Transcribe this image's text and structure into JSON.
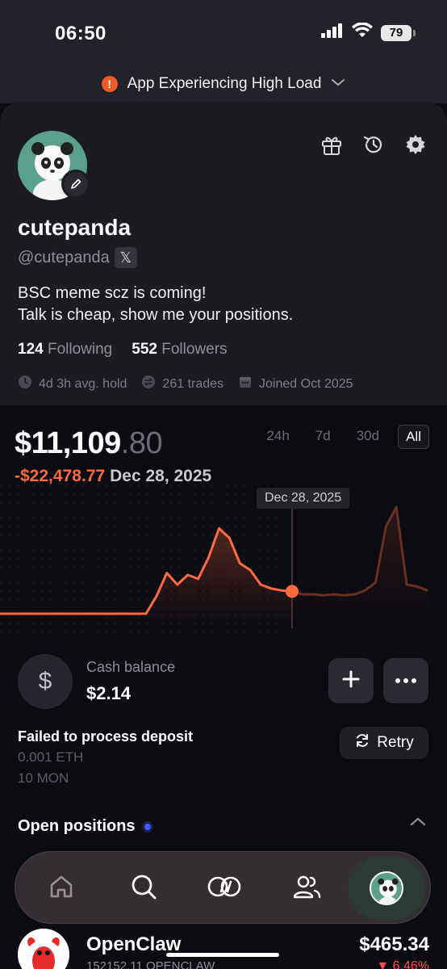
{
  "status": {
    "time": "06:50",
    "battery": "79"
  },
  "banner": {
    "icon": "!",
    "text": "App Experiencing High Load"
  },
  "profile": {
    "username": "cutepanda",
    "handle": "@cutepanda",
    "x_icon": "𝕏",
    "bio_line1": "BSC meme scz is coming!",
    "bio_line2": "Talk is cheap, show me your positions.",
    "following_count": "124",
    "following_label": "Following",
    "followers_count": "552",
    "followers_label": "Followers",
    "avg_hold": "4d 3h avg. hold",
    "trades": "261 trades",
    "joined": "Joined Oct 2025"
  },
  "portfolio": {
    "value_dollars": "$11,109",
    "value_cents": ".80",
    "pnl": "-$22,478.77",
    "date": "Dec 28, 2025",
    "tooltip": "Dec 28, 2025",
    "ranges": [
      "24h",
      "7d",
      "30d",
      "All"
    ],
    "active_range": "All"
  },
  "chart_data": {
    "type": "area",
    "title": "",
    "xlabel": "",
    "ylabel": "",
    "highlight_index": 28,
    "x": [
      0,
      1,
      2,
      3,
      4,
      5,
      6,
      7,
      8,
      9,
      10,
      11,
      12,
      13,
      14,
      15,
      16,
      17,
      18,
      19,
      20,
      21,
      22,
      23,
      24,
      25,
      26,
      27,
      28,
      29,
      30,
      31,
      32,
      33,
      34,
      35,
      36,
      37,
      38,
      39,
      40,
      41
    ],
    "series": [
      {
        "values": [
          10,
          10,
          10,
          10,
          10,
          10,
          10,
          10,
          10,
          10,
          10,
          10,
          10,
          10,
          10,
          28,
          52,
          40,
          50,
          46,
          68,
          98,
          88,
          62,
          55,
          40,
          36,
          34,
          33,
          30,
          30,
          29,
          30,
          29,
          30,
          34,
          42,
          100,
          120,
          40,
          38,
          34
        ]
      }
    ],
    "colors": {
      "line": "#ff6a3d",
      "fill": "#ff6a3d"
    }
  },
  "cash": {
    "icon": "$",
    "label": "Cash balance",
    "value": "$2.14"
  },
  "deposit": {
    "title": "Failed to process deposit",
    "line1": "0.001 ETH",
    "line2": "10 MON",
    "retry_label": "Retry"
  },
  "positions": {
    "header": "Open positions",
    "items": [
      {
        "name": "OpenClaw",
        "sub": "152152.11 OPENCLAW",
        "value": "$465.34",
        "change": "▼ 6.46%"
      }
    ]
  },
  "tabs": [
    "home-tab",
    "search-tab",
    "trade-tab",
    "community-tab",
    "profile-tab"
  ]
}
